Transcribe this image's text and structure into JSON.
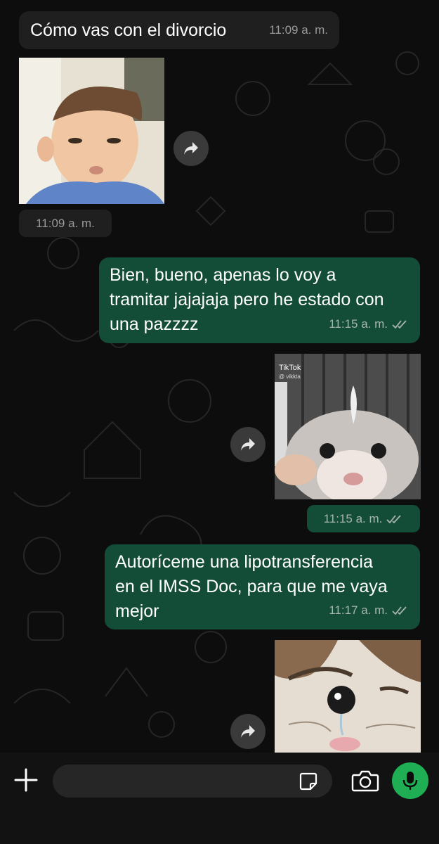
{
  "messages": [
    {
      "text": "Cómo vas con el divorcio",
      "time": "11:09 a. m."
    },
    {
      "sticker": "baby-face-sticker",
      "time": "11:09 a. m."
    },
    {
      "lines": [
        "Bien, bueno, apenas lo voy a",
        "tramitar jajajaja pero he estado con",
        "una pazzzz"
      ],
      "time": "11:15 a. m."
    },
    {
      "sticker": "hamster-sticker",
      "watermark": "TikTok",
      "handle": "@ vikkta",
      "time": "11:15 a. m."
    },
    {
      "lines": [
        "Autoríceme una lipotransferencia",
        "en el IMSS Doc, para que me vaya",
        "mejor"
      ],
      "time": "11:17 a. m."
    },
    {
      "sticker": "crying-kitten-sticker"
    }
  ],
  "input": {
    "placeholder": ""
  },
  "icons": {
    "plus": "plus-icon",
    "sticker": "sticker-icon",
    "camera": "camera-icon",
    "mic": "microphone-icon",
    "forward": "forward-icon",
    "read": "double-check-icon"
  },
  "colors": {
    "incoming_bubble": "#1f1f1f",
    "outgoing_bubble": "#134d37",
    "mic_button": "#1fae54",
    "background": "#0d0d0d"
  }
}
